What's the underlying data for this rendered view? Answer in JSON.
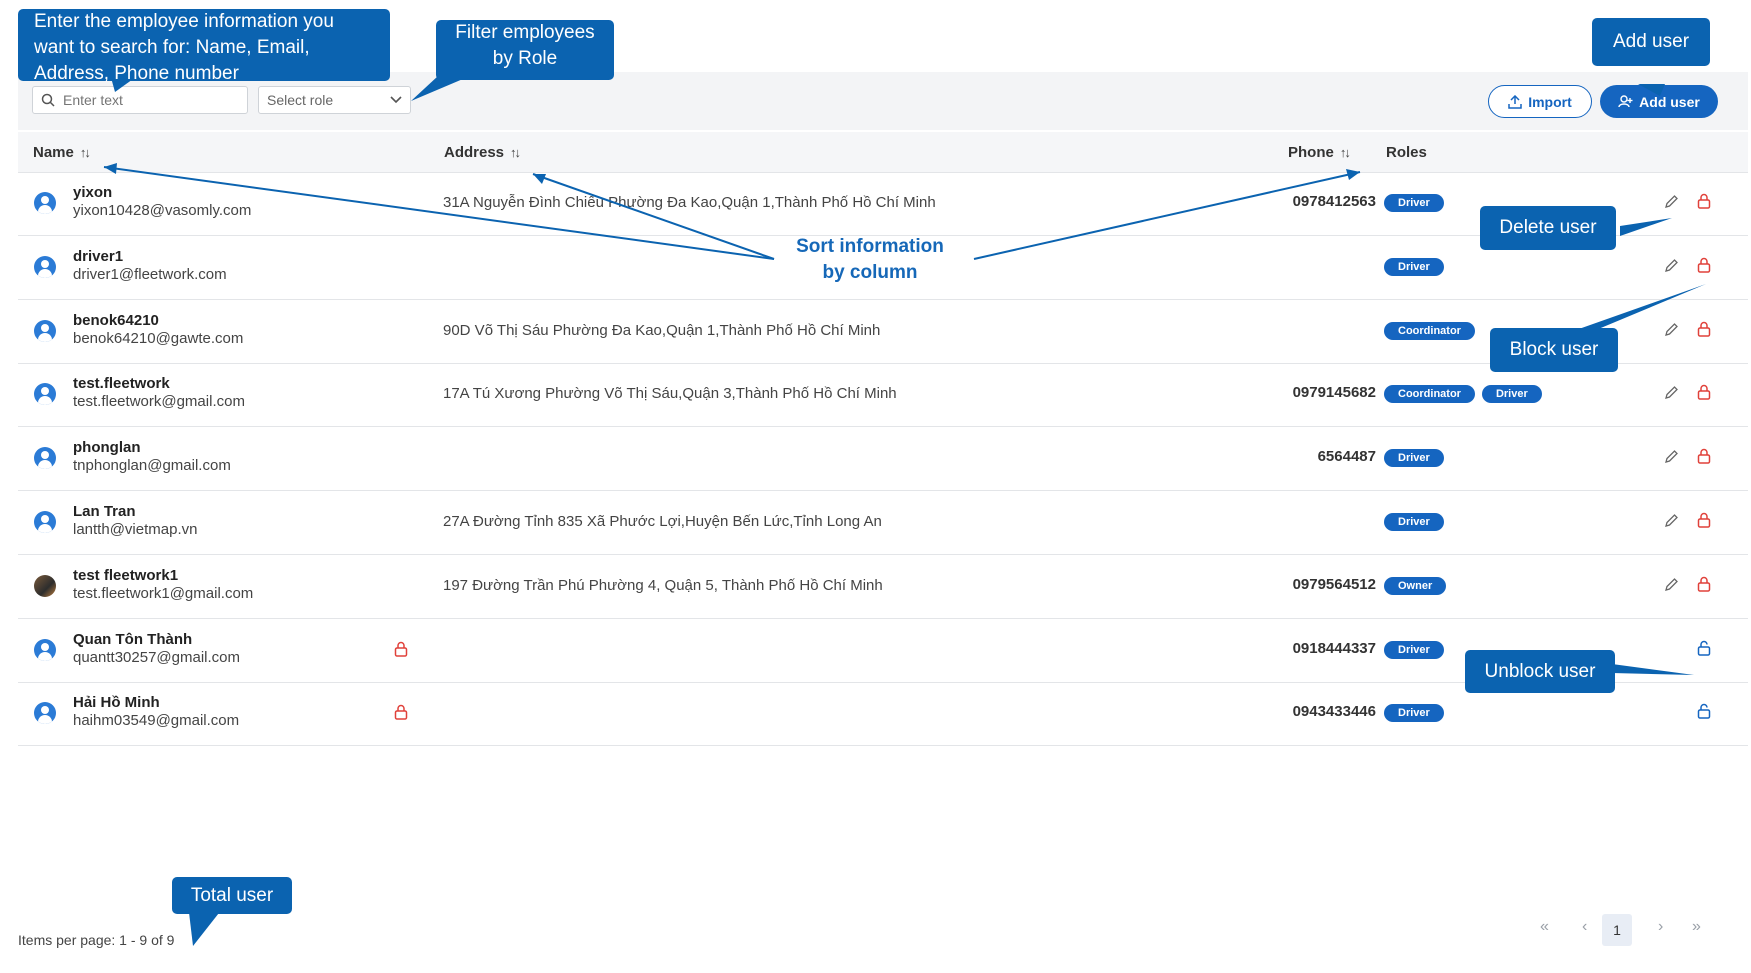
{
  "toolbar": {
    "search_placeholder": "Enter text",
    "role_select_value": "Select role",
    "import_label": "Import",
    "add_user_label": "Add user"
  },
  "table": {
    "columns": [
      "Name",
      "Address",
      "Phone",
      "Roles"
    ],
    "rows": [
      {
        "name": "yixon",
        "email": "yixon10428@vasomly.com",
        "address": "31A Nguyễn Đình Chiểu Phường Đa Kao,Quận 1,Thành Phố Hồ Chí Minh",
        "phone": "0978412563",
        "roles": [
          "Driver"
        ],
        "blocked": false
      },
      {
        "name": "driver1",
        "email": "driver1@fleetwork.com",
        "address": "",
        "phone": "",
        "roles": [
          "Driver"
        ],
        "blocked": false
      },
      {
        "name": "benok64210",
        "email": "benok64210@gawte.com",
        "address": "90D Võ Thị Sáu Phường Đa Kao,Quận 1,Thành Phố Hồ Chí Minh",
        "phone": "",
        "roles": [
          "Coordinator"
        ],
        "blocked": false
      },
      {
        "name": "test.fleetwork",
        "email": "test.fleetwork@gmail.com",
        "address": "17A Tú Xương Phường Võ Thị Sáu,Quận 3,Thành Phố Hồ Chí Minh",
        "phone": "0979145682",
        "roles": [
          "Coordinator",
          "Driver"
        ],
        "blocked": false
      },
      {
        "name": "phonglan",
        "email": "tnphonglan@gmail.com",
        "address": "",
        "phone": "6564487",
        "roles": [
          "Driver"
        ],
        "blocked": false
      },
      {
        "name": "Lan Tran",
        "email": "lantth@vietmap.vn",
        "address": "27A Đường Tỉnh 835 Xã Phước Lợi,Huyện Bến Lức,Tỉnh Long An",
        "phone": "",
        "roles": [
          "Driver"
        ],
        "blocked": false
      },
      {
        "name": "test fleetwork1",
        "email": "test.fleetwork1@gmail.com",
        "address": "197 Đường Trần Phú Phường 4, Quận 5, Thành Phố Hồ Chí Minh",
        "phone": "0979564512",
        "roles": [
          "Owner"
        ],
        "blocked": false
      },
      {
        "name": "Quan Tôn Thành",
        "email": "quantt30257@gmail.com",
        "address": "",
        "phone": "0918444337",
        "roles": [
          "Driver"
        ],
        "blocked": true
      },
      {
        "name": "Hải Hồ Minh",
        "email": "haihm03549@gmail.com",
        "address": "",
        "phone": "0943433446",
        "roles": [
          "Driver"
        ],
        "blocked": true
      }
    ]
  },
  "footer": {
    "items_per_page": "Items per page: 1 - 9 of 9",
    "current_page": "1",
    "first": "«",
    "prev": "‹",
    "next": "›",
    "last": "»"
  },
  "annotations": {
    "search": "Enter the employee information you want to search for: Name, Email, Address, Phone number",
    "filter_line1": "Filter employees",
    "filter_line2": "by Role",
    "add_user": "Add user",
    "sort_line1": "Sort information",
    "sort_line2": "by column",
    "delete_user": "Delete user",
    "block_user": "Block user",
    "unblock_user": "Unblock user",
    "total_user": "Total user"
  },
  "colors": {
    "accent": "#1565c0",
    "callout": "#0b63b0",
    "lock_red": "#e0413a"
  }
}
